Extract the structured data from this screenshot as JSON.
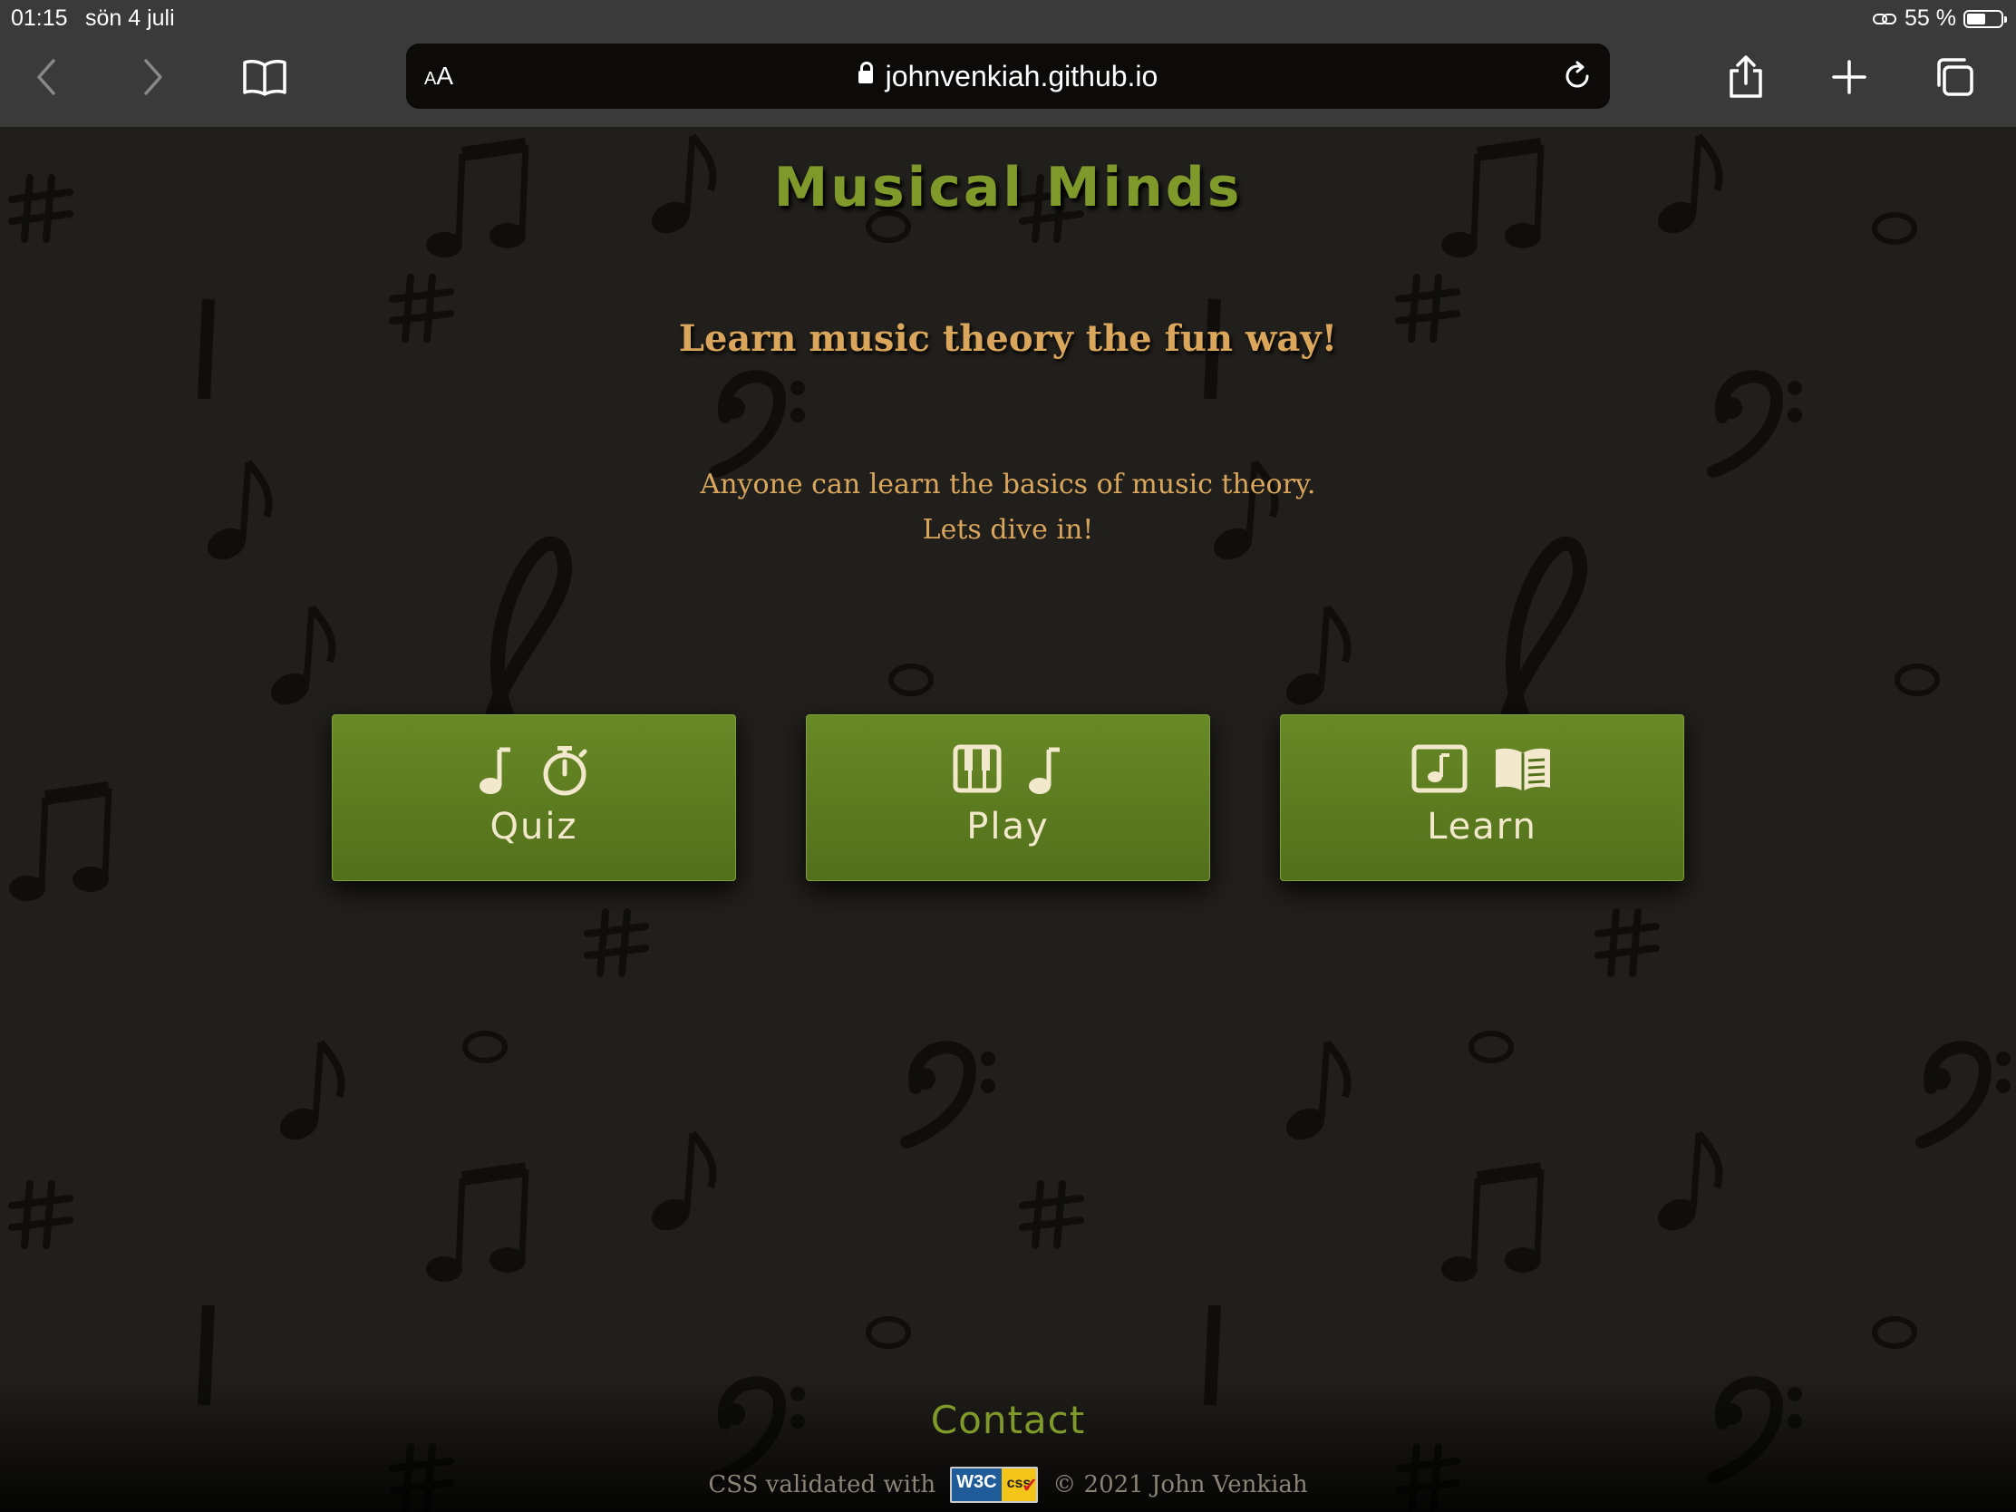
{
  "status_bar": {
    "time": "01:15",
    "date": "sön 4 juli",
    "battery_text": "55 %",
    "battery_level": 0.55,
    "icons": [
      "link-icon",
      "battery-icon"
    ]
  },
  "browser": {
    "text_size_button": "AA",
    "url": "johnvenkiah.github.io",
    "icons": [
      "back-icon",
      "forward-icon",
      "bookmarks-icon",
      "lock-icon",
      "reload-icon",
      "share-icon",
      "new-tab-icon",
      "tabs-icon"
    ]
  },
  "page": {
    "title": "Musical Minds",
    "subtitle": "Learn music theory the fun way!",
    "intro_line1": "Anyone can learn the basics of music theory.",
    "intro_line2": "Lets dive in!",
    "buttons": [
      {
        "label": "Quiz",
        "icons": [
          "music-note-icon",
          "stopwatch-icon"
        ]
      },
      {
        "label": "Play",
        "icons": [
          "piano-icon",
          "music-note-icon"
        ]
      },
      {
        "label": "Learn",
        "icons": [
          "music-sheet-icon",
          "open-book-icon"
        ]
      }
    ],
    "footer": {
      "contact": "Contact",
      "validated_text": "CSS validated with",
      "badge_left": "W3C",
      "badge_right": "css",
      "copyright": "© 2021 John Venkiah"
    },
    "colors": {
      "background": "#211f1b",
      "title_green": "#7f9a2a",
      "accent_gold": "#d9a65c",
      "button_green": "#688926",
      "button_text": "#f2e8cc"
    }
  }
}
